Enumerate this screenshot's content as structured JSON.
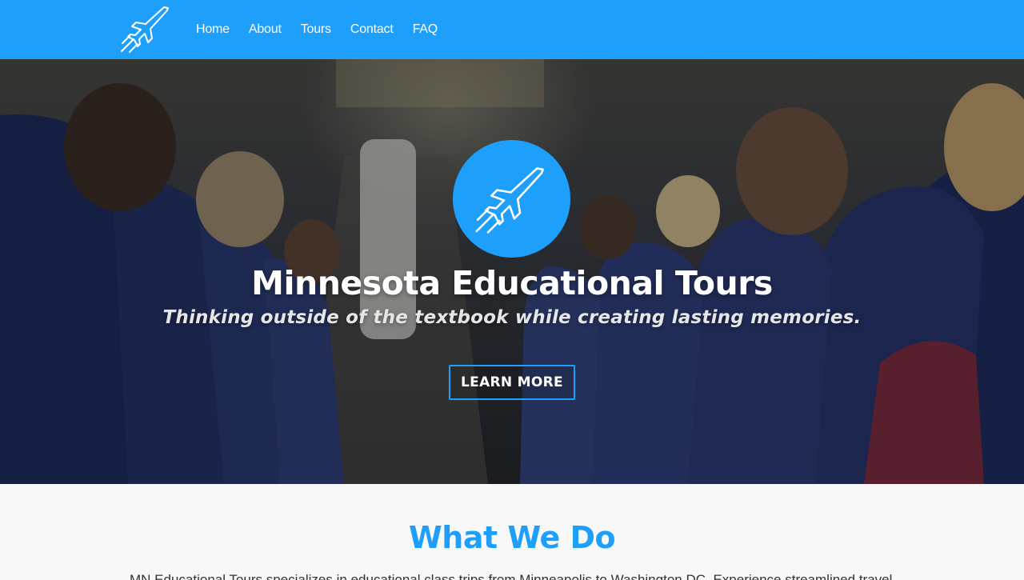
{
  "colors": {
    "accent": "#1e9ffb",
    "nav_text": "#ffffff",
    "section_bg": "#f8f8f8"
  },
  "navbar": {
    "logo_icon": "airplane-icon",
    "links": [
      "Home",
      "About",
      "Tours",
      "Contact",
      "FAQ"
    ]
  },
  "hero": {
    "badge_icon": "airplane-icon",
    "title": "Minnesota Educational Tours",
    "subtitle": "Thinking outside of the textbook while creating lasting memories.",
    "cta_label": "LEARN MORE"
  },
  "what_we_do": {
    "title": "What We Do",
    "text": "MN Educational Tours specializes in educational class trips from Minneapolis to Washington DC. Experience streamlined travel…"
  }
}
